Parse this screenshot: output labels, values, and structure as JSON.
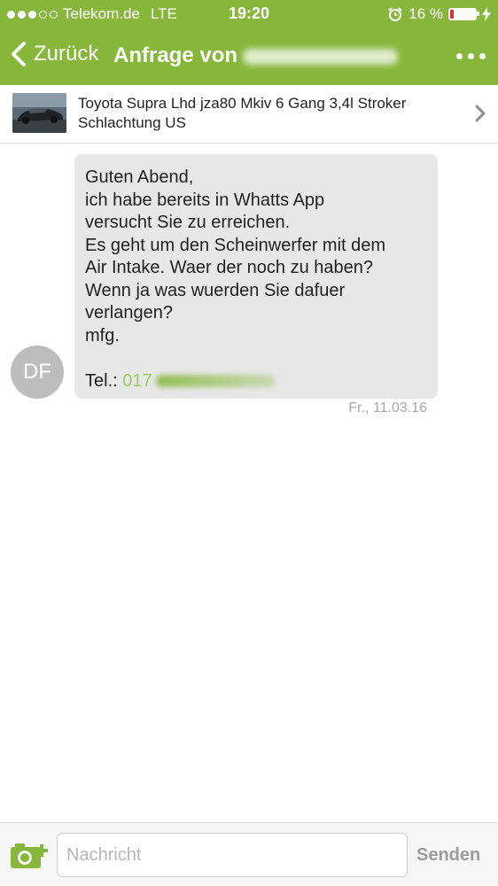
{
  "status_bar": {
    "carrier": "Telekom.de",
    "network": "LTE",
    "time": "19:20",
    "battery_percent": "16 %",
    "battery_level": 0.16
  },
  "nav": {
    "back_label": "Zurück",
    "title": "Anfrage von",
    "accent_color": "#86b63a"
  },
  "listing": {
    "title": "Toyota Supra Lhd jza80 Mkiv 6 Gang 3,4l Stroker Schlachtung US"
  },
  "message": {
    "lines": [
      "Guten Abend,",
      "ich habe bereits in Whatts App",
      "versucht Sie zu erreichen.",
      "Es geht um den Scheinwerfer mit dem",
      "Air Intake. Waer der noch zu haben?",
      "Wenn ja was wuerden Sie dafuer",
      "verlangen?",
      "mfg."
    ],
    "phone_label": "Tel.:",
    "phone_visible": "017",
    "timestamp": "Fr., 11.03.16",
    "avatar_initials": "DF"
  },
  "composer": {
    "placeholder": "Nachricht",
    "send_label": "Senden"
  },
  "icons": {
    "back": "chevron-left-icon",
    "more": "more-dots-icon",
    "listing_arrow": "chevron-right-icon",
    "camera": "camera-add-icon",
    "alarm": "alarm-icon",
    "charging": "bolt-icon"
  }
}
